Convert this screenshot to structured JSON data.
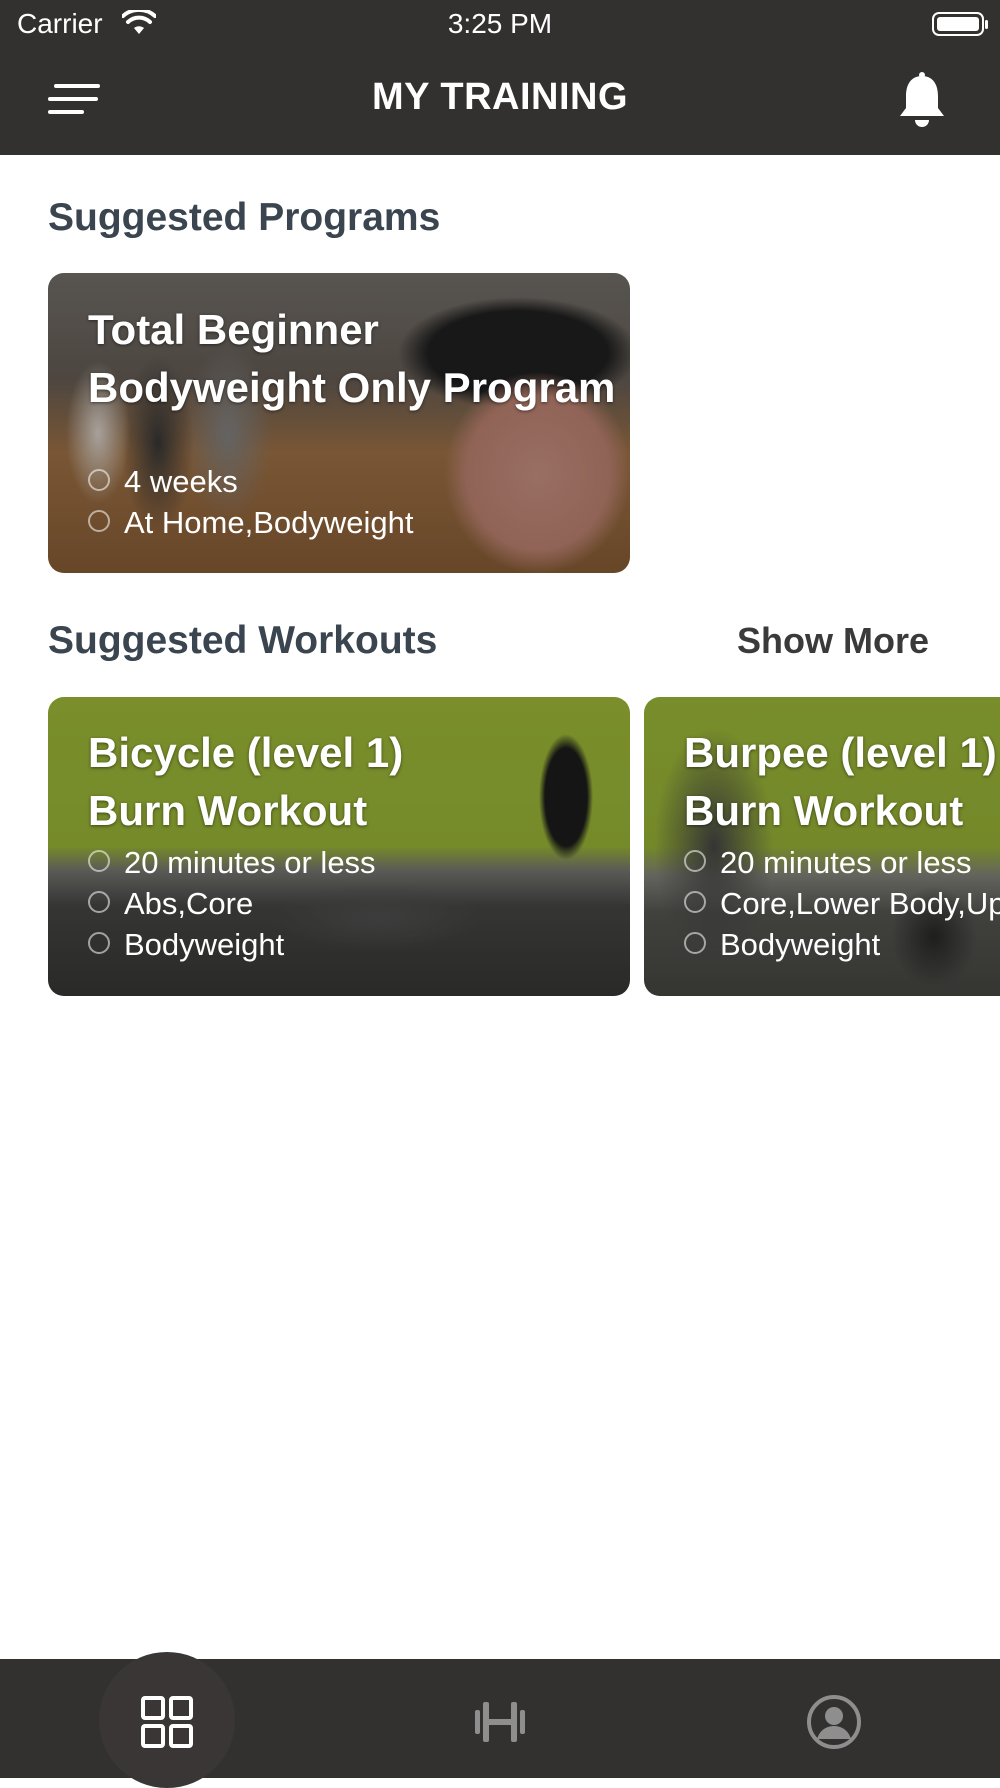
{
  "status_bar": {
    "carrier": "Carrier",
    "time": "3:25 PM"
  },
  "header": {
    "title": "MY TRAINING",
    "menu_icon": "menu-icon",
    "bell_icon": "bell-icon"
  },
  "programs": {
    "section_title": "Suggested Programs",
    "items": [
      {
        "title_line1": "Total Beginner",
        "title_line2": "Bodyweight Only Program",
        "duration": "4 weeks",
        "tags": "At Home,Bodyweight"
      }
    ]
  },
  "workouts": {
    "section_title": "Suggested Workouts",
    "show_more": "Show More",
    "items": [
      {
        "title_line1": "Bicycle (level 1)",
        "title_line2": "Burn Workout",
        "duration": "20 minutes or less",
        "body_parts": "Abs,Core",
        "equipment": "Bodyweight"
      },
      {
        "title_line1": "Burpee (level 1)",
        "title_line2": "Burn Workout",
        "duration": "20 minutes or less",
        "body_parts": "Core,Lower Body,Upper Body",
        "equipment": "Bodyweight"
      }
    ]
  },
  "tab_bar": {
    "items": [
      {
        "icon": "dashboard-grid-icon",
        "active": true
      },
      {
        "icon": "dumbbell-icon",
        "active": false
      },
      {
        "icon": "profile-icon",
        "active": false
      }
    ]
  },
  "colors": {
    "bar": "#333030",
    "section_title": "#3a4550",
    "accent_green": "#a8c83a"
  }
}
